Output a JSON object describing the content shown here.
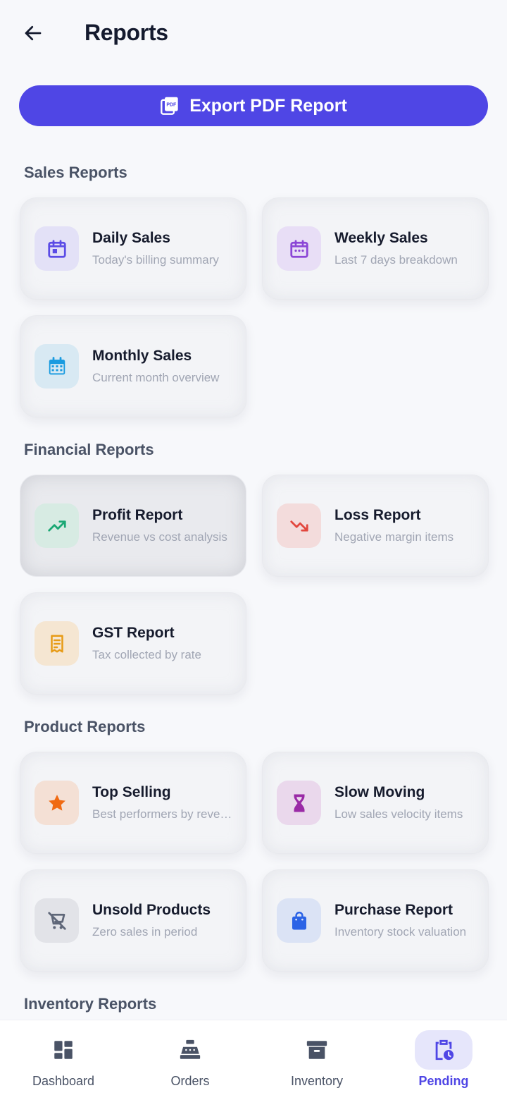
{
  "header": {
    "title": "Reports"
  },
  "export": {
    "label": "Export PDF Report"
  },
  "sections": [
    {
      "title": "Sales Reports",
      "cards": [
        {
          "title": "Daily Sales",
          "subtitle": "Today's billing summary",
          "icon": "calendar-today-icon",
          "color": "#5b4ce6",
          "bg": "#e3e1f7"
        },
        {
          "title": "Weekly Sales",
          "subtitle": "Last 7 days breakdown",
          "icon": "calendar-week-icon",
          "color": "#8b46d6",
          "bg": "#e8def6"
        },
        {
          "title": "Monthly Sales",
          "subtitle": "Current month overview",
          "icon": "calendar-month-icon",
          "color": "#1a9be0",
          "bg": "#d8e9f3"
        }
      ]
    },
    {
      "title": "Financial Reports",
      "cards": [
        {
          "title": "Profit Report",
          "subtitle": "Revenue vs cost analysis",
          "icon": "trending-up-icon",
          "color": "#1aa874",
          "bg": "#d7ebe3"
        },
        {
          "title": "Loss Report",
          "subtitle": "Negative margin items",
          "icon": "trending-down-icon",
          "color": "#e2473e",
          "bg": "#f3dcdc"
        },
        {
          "title": "GST Report",
          "subtitle": "Tax collected by rate",
          "icon": "receipt-icon",
          "color": "#e79b16",
          "bg": "#f5e6d2"
        }
      ]
    },
    {
      "title": "Product Reports",
      "cards": [
        {
          "title": "Top Selling",
          "subtitle": "Best performers by revenue",
          "icon": "star-icon",
          "color": "#f06a12",
          "bg": "#f4e0d5"
        },
        {
          "title": "Slow Moving",
          "subtitle": "Low sales velocity items",
          "icon": "hourglass-icon",
          "color": "#9a2aa6",
          "bg": "#ead8ec"
        },
        {
          "title": "Unsold Products",
          "subtitle": "Zero sales in period",
          "icon": "remove-cart-icon",
          "color": "#5f6779",
          "bg": "#e2e3e8"
        },
        {
          "title": "Purchase Report",
          "subtitle": "Inventory stock valuation",
          "icon": "shopping-bag-icon",
          "color": "#2b63e6",
          "bg": "#dbe3f5"
        }
      ]
    },
    {
      "title": "Inventory Reports",
      "cards": []
    }
  ],
  "nav": [
    {
      "label": "Dashboard",
      "icon": "dashboard-icon"
    },
    {
      "label": "Orders",
      "icon": "cash-register-icon"
    },
    {
      "label": "Inventory",
      "icon": "archive-box-icon"
    },
    {
      "label": "Pending",
      "icon": "pending-clipboard-icon",
      "active": true
    }
  ]
}
